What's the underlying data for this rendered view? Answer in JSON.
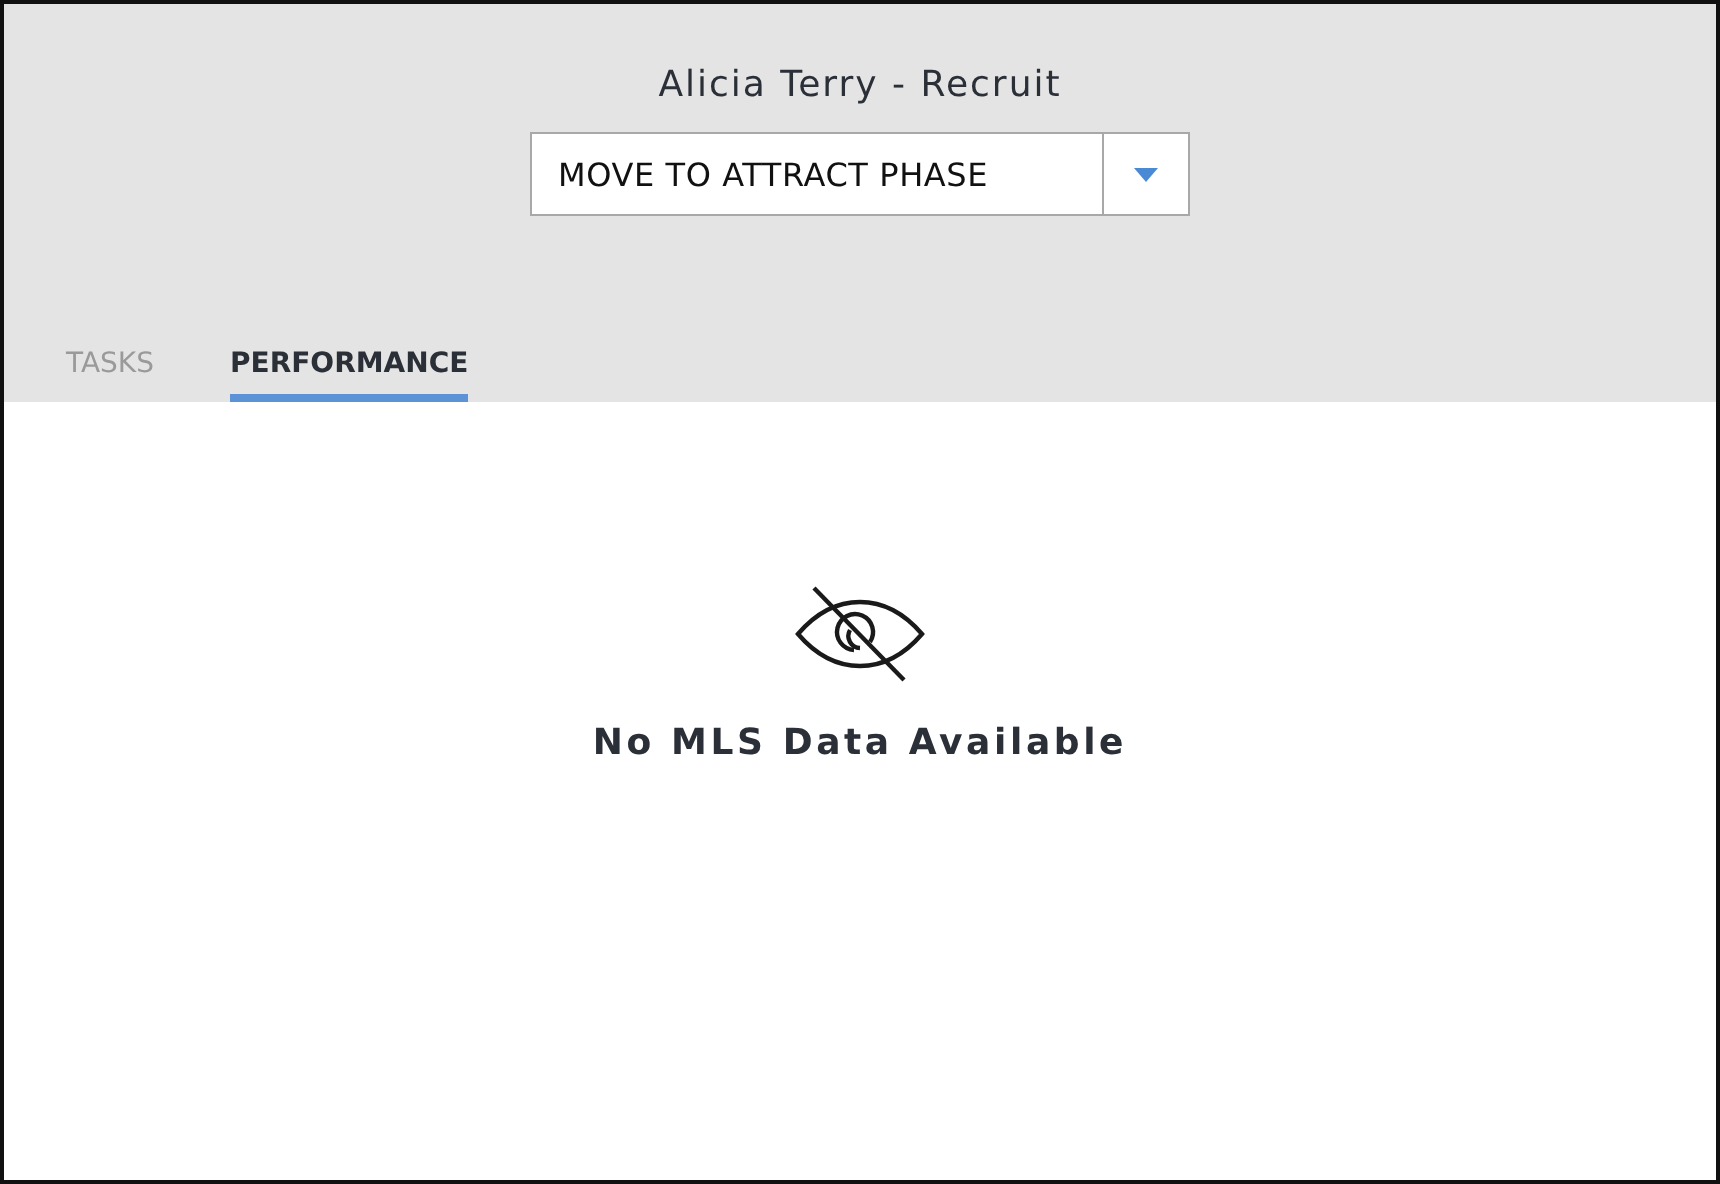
{
  "header": {
    "title": "Alicia Terry - Recruit"
  },
  "phase_dropdown": {
    "value": "MOVE TO ATTRACT PHASE"
  },
  "tabs": [
    {
      "label": "TASKS",
      "selected": false
    },
    {
      "label": "PERFORMANCE",
      "selected": true
    }
  ],
  "empty_state": {
    "message": "No MLS Data Available"
  }
}
